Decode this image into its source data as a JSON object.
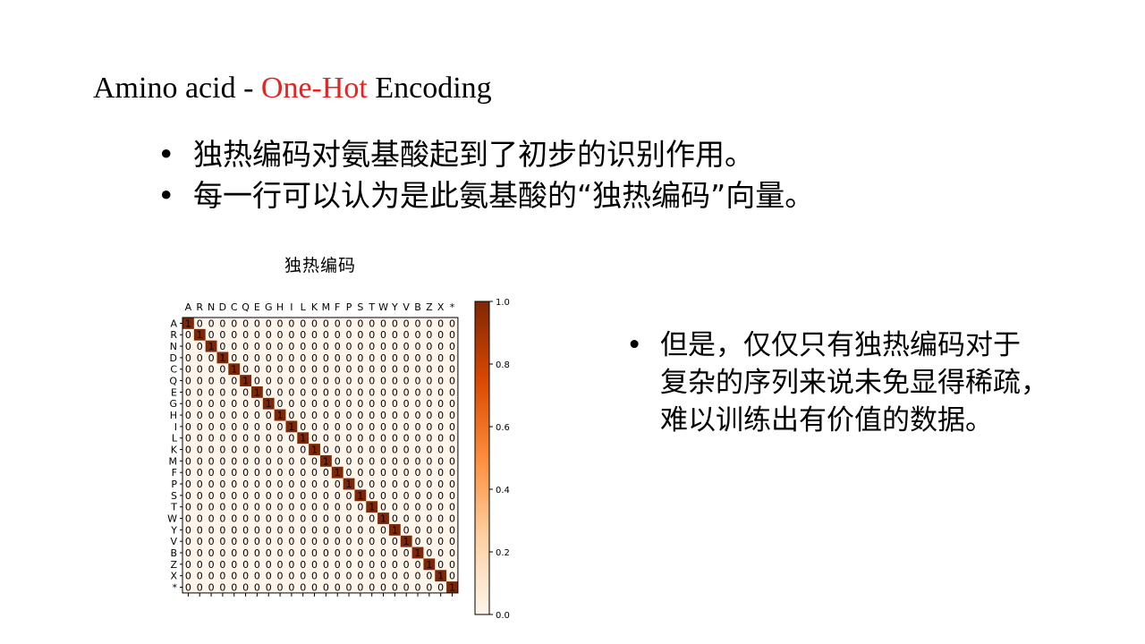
{
  "slide": {
    "title_prefix": "Amino acid - ",
    "title_accent": "One-Hot",
    "title_suffix": " Encoding",
    "bullets": [
      "独热编码对氨基酸起到了初步的识别作用。",
      "每一行可以认为是此氨基酸的“独热编码”向量。"
    ],
    "side_note": {
      "lines": [
        "但是，仅仅只有独热编码对于",
        "复杂的序列来说未免显得稀疏，",
        "难以训练出有价值的数据。"
      ]
    },
    "accent_color": "#e8231f"
  },
  "chart_data": {
    "type": "heatmap",
    "title": "独热编码",
    "labels": [
      "A",
      "R",
      "N",
      "D",
      "C",
      "Q",
      "E",
      "G",
      "H",
      "I",
      "L",
      "K",
      "M",
      "F",
      "P",
      "S",
      "T",
      "W",
      "Y",
      "V",
      "B",
      "Z",
      "X",
      "*"
    ],
    "matrix_rule": "identity",
    "cell_value_on": 1,
    "cell_value_off": 0,
    "colorbar": {
      "min": 0.0,
      "max": 1.0,
      "ticks": [
        "0.0",
        "0.2",
        "0.4",
        "0.6",
        "0.8",
        "1.0"
      ]
    },
    "colormap": "Oranges",
    "color_low": "#fff5eb",
    "color_high": "#7f2704"
  }
}
